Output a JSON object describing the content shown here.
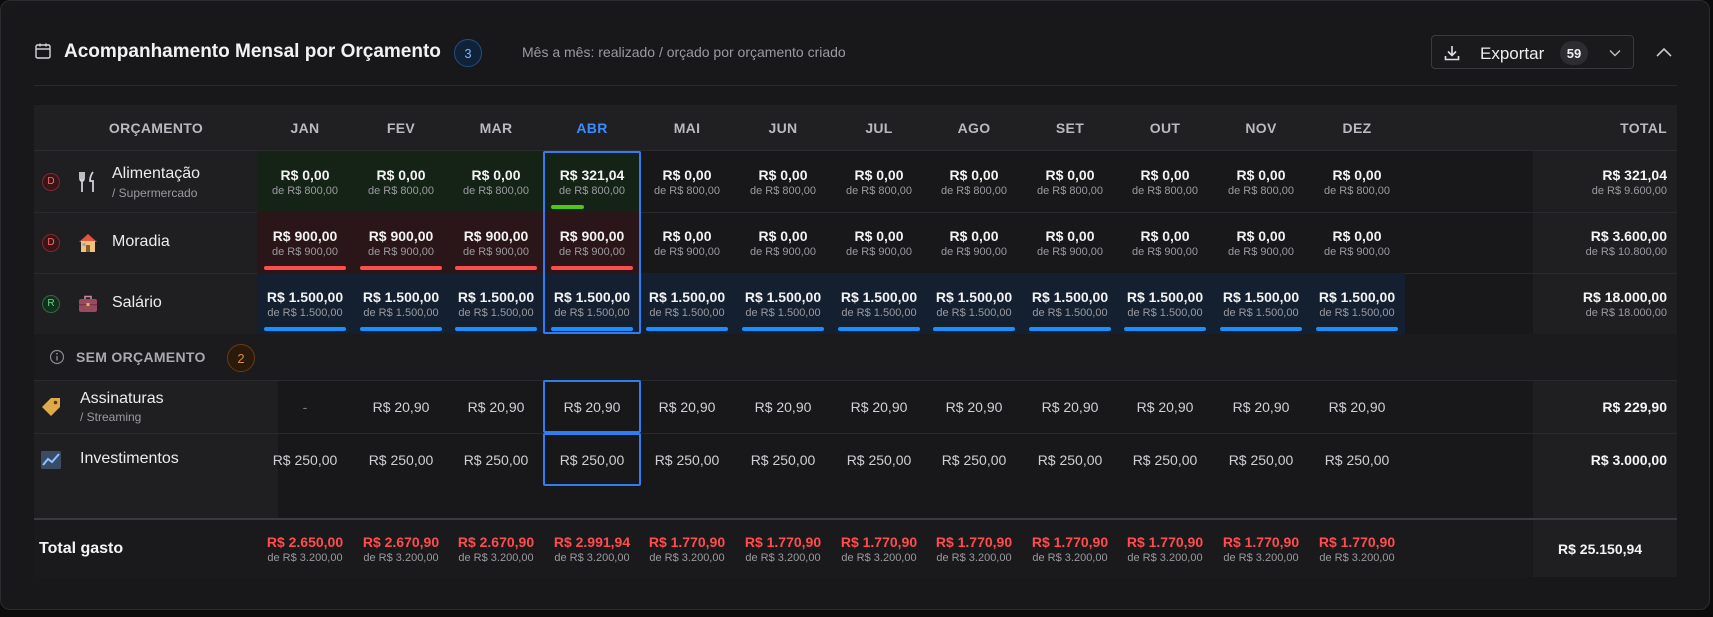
{
  "header": {
    "title": "Acompanhamento Mensal por Orçamento",
    "count": "3",
    "subtitle": "Mês a mês: realizado / orçado por orçamento criado",
    "export_label": "Exportar",
    "export_count": "59"
  },
  "table": {
    "label_header": "ORÇAMENTO",
    "total_header": "TOTAL",
    "months": [
      "JAN",
      "FEV",
      "MAR",
      "ABR",
      "MAI",
      "JUN",
      "JUL",
      "AGO",
      "SET",
      "OUT",
      "NOV",
      "DEZ"
    ],
    "current_month": "ABR",
    "budget_rows": [
      {
        "badge": "D",
        "badge_kind": "despesa",
        "icon": "fork-knife-icon",
        "name": "Alimentação",
        "sub": "/ Supermercado",
        "values": [
          "R$ 0,00",
          "R$ 0,00",
          "R$ 0,00",
          "R$ 321,04",
          "R$ 0,00",
          "R$ 0,00",
          "R$ 0,00",
          "R$ 0,00",
          "R$ 0,00",
          "R$ 0,00",
          "R$ 0,00",
          "R$ 0,00"
        ],
        "budgets": [
          "de R$ 800,00",
          "de R$ 800,00",
          "de R$ 800,00",
          "de R$ 800,00",
          "de R$ 800,00",
          "de R$ 800,00",
          "de R$ 800,00",
          "de R$ 800,00",
          "de R$ 800,00",
          "de R$ 800,00",
          "de R$ 800,00",
          "de R$ 800,00"
        ],
        "progress": [
          0,
          0,
          0,
          0.4,
          0,
          0,
          0,
          0,
          0,
          0,
          0,
          0
        ],
        "cell_tint": [
          "#142316",
          "#142316",
          "#142316",
          "#142316",
          "",
          "",
          "",
          "",
          "",
          "",
          "",
          ""
        ],
        "bar_color": "#52c41a",
        "total": "R$ 321,04",
        "total_budget": "de R$ 9.600,00"
      },
      {
        "badge": "D",
        "badge_kind": "despesa",
        "icon": "house-icon",
        "name": "Moradia",
        "sub": "",
        "values": [
          "R$ 900,00",
          "R$ 900,00",
          "R$ 900,00",
          "R$ 900,00",
          "R$ 0,00",
          "R$ 0,00",
          "R$ 0,00",
          "R$ 0,00",
          "R$ 0,00",
          "R$ 0,00",
          "R$ 0,00",
          "R$ 0,00"
        ],
        "budgets": [
          "de R$ 900,00",
          "de R$ 900,00",
          "de R$ 900,00",
          "de R$ 900,00",
          "de R$ 900,00",
          "de R$ 900,00",
          "de R$ 900,00",
          "de R$ 900,00",
          "de R$ 900,00",
          "de R$ 900,00",
          "de R$ 900,00",
          "de R$ 900,00"
        ],
        "progress": [
          1,
          1,
          1,
          1,
          0,
          0,
          0,
          0,
          0,
          0,
          0,
          0
        ],
        "cell_tint": [
          "#2a1618",
          "#2a1618",
          "#2a1618",
          "#2a1618",
          "",
          "",
          "",
          "",
          "",
          "",
          "",
          ""
        ],
        "bar_color": "#ff4d4f",
        "total": "R$ 3.600,00",
        "total_budget": "de R$ 10.800,00"
      },
      {
        "badge": "R",
        "badge_kind": "receita",
        "icon": "briefcase-icon",
        "name": "Salário",
        "sub": "",
        "values": [
          "R$ 1.500,00",
          "R$ 1.500,00",
          "R$ 1.500,00",
          "R$ 1.500,00",
          "R$ 1.500,00",
          "R$ 1.500,00",
          "R$ 1.500,00",
          "R$ 1.500,00",
          "R$ 1.500,00",
          "R$ 1.500,00",
          "R$ 1.500,00",
          "R$ 1.500,00"
        ],
        "budgets": [
          "de R$ 1.500,00",
          "de R$ 1.500,00",
          "de R$ 1.500,00",
          "de R$ 1.500,00",
          "de R$ 1.500,00",
          "de R$ 1.500,00",
          "de R$ 1.500,00",
          "de R$ 1.500,00",
          "de R$ 1.500,00",
          "de R$ 1.500,00",
          "de R$ 1.500,00",
          "de R$ 1.500,00"
        ],
        "progress": [
          1,
          1,
          1,
          1,
          1,
          1,
          1,
          1,
          1,
          1,
          1,
          1
        ],
        "cell_tint": [
          "#142030",
          "#142030",
          "#142030",
          "#142030",
          "#142030",
          "#142030",
          "#142030",
          "#142030",
          "#142030",
          "#142030",
          "#142030",
          "#142030"
        ],
        "bar_color": "#1890ff",
        "total": "R$ 18.000,00",
        "total_budget": "de R$ 18.000,00"
      }
    ],
    "section": {
      "label": "SEM ORÇAMENTO",
      "count": "2"
    },
    "unbudgeted_rows": [
      {
        "icon": "tag-icon",
        "name": "Assinaturas",
        "sub": "/ Streaming",
        "values": [
          "-",
          "R$ 20,90",
          "R$ 20,90",
          "R$ 20,90",
          "R$ 20,90",
          "R$ 20,90",
          "R$ 20,90",
          "R$ 20,90",
          "R$ 20,90",
          "R$ 20,90",
          "R$ 20,90",
          "R$ 20,90"
        ],
        "total": "R$ 229,90"
      },
      {
        "icon": "chart-icon",
        "name": "Investimentos",
        "sub": "",
        "values": [
          "R$ 250,00",
          "R$ 250,00",
          "R$ 250,00",
          "R$ 250,00",
          "R$ 250,00",
          "R$ 250,00",
          "R$ 250,00",
          "R$ 250,00",
          "R$ 250,00",
          "R$ 250,00",
          "R$ 250,00",
          "R$ 250,00"
        ],
        "total": "R$ 3.000,00"
      }
    ],
    "footer": {
      "label": "Total gasto",
      "values": [
        "R$ 2.650,00",
        "R$ 2.670,90",
        "R$ 2.670,90",
        "R$ 2.991,94",
        "R$ 1.770,90",
        "R$ 1.770,90",
        "R$ 1.770,90",
        "R$ 1.770,90",
        "R$ 1.770,90",
        "R$ 1.770,90",
        "R$ 1.770,90",
        "R$ 1.770,90"
      ],
      "budgets": [
        "de R$ 3.200,00",
        "de R$ 3.200,00",
        "de R$ 3.200,00",
        "de R$ 3.200,00",
        "de R$ 3.200,00",
        "de R$ 3.200,00",
        "de R$ 3.200,00",
        "de R$ 3.200,00",
        "de R$ 3.200,00",
        "de R$ 3.200,00",
        "de R$ 3.200,00",
        "de R$ 3.200,00"
      ],
      "total": "R$ 25.150,94"
    }
  },
  "colors": {
    "accent": "#2f7df0",
    "over_budget": "#ff4d4f",
    "ok": "#52c41a",
    "income": "#1890ff"
  }
}
